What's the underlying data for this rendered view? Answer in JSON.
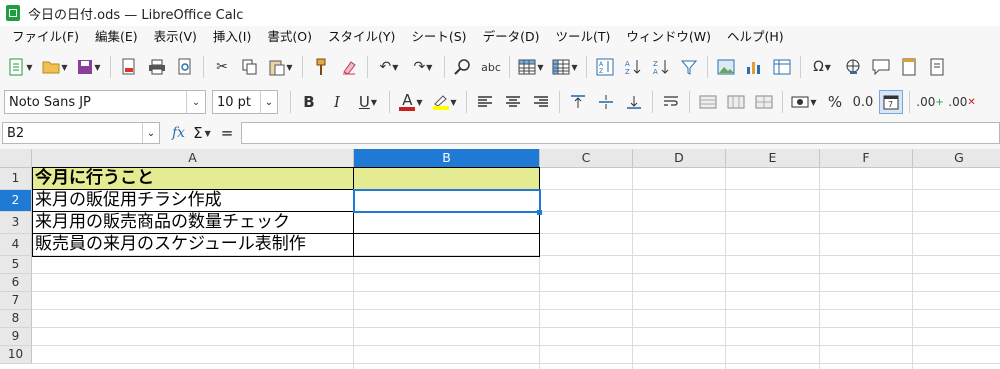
{
  "window": {
    "title": "今日の日付.ods — LibreOffice Calc"
  },
  "menu": [
    "ファイル(F)",
    "編集(E)",
    "表示(V)",
    "挿入(I)",
    "書式(O)",
    "スタイル(Y)",
    "シート(S)",
    "データ(D)",
    "ツール(T)",
    "ウィンドウ(W)",
    "ヘルプ(H)"
  ],
  "format": {
    "font_name": "Noto Sans JP",
    "font_size": "10 pt",
    "bold": "B",
    "italic": "I",
    "underline": "U",
    "font_color": "A",
    "percent": "%",
    "number": "0.0",
    "add_decimal": ".00",
    "del_decimal": ".00"
  },
  "formula": {
    "cell_ref": "B2",
    "fx": "fx",
    "sigma": "Σ",
    "equals": "=",
    "content": ""
  },
  "sheet": {
    "columns": [
      "A",
      "B",
      "C",
      "D",
      "E",
      "F",
      "G"
    ],
    "selected_column": "B",
    "rows": [
      "1",
      "2",
      "3",
      "4",
      "5",
      "6",
      "7",
      "8",
      "9",
      "10"
    ],
    "selected_row": "2",
    "header_fill": "#e5eb92",
    "selection_color": "#1e7ad4",
    "cells": {
      "A1": "今月に行うこと",
      "A2": "来月の販促用チラシ作成",
      "A3": "来月用の販売商品の数量チェック",
      "A4": "販売員の来月のスケジュール表制作",
      "B1": "",
      "B2": "",
      "B3": "",
      "B4": ""
    }
  }
}
